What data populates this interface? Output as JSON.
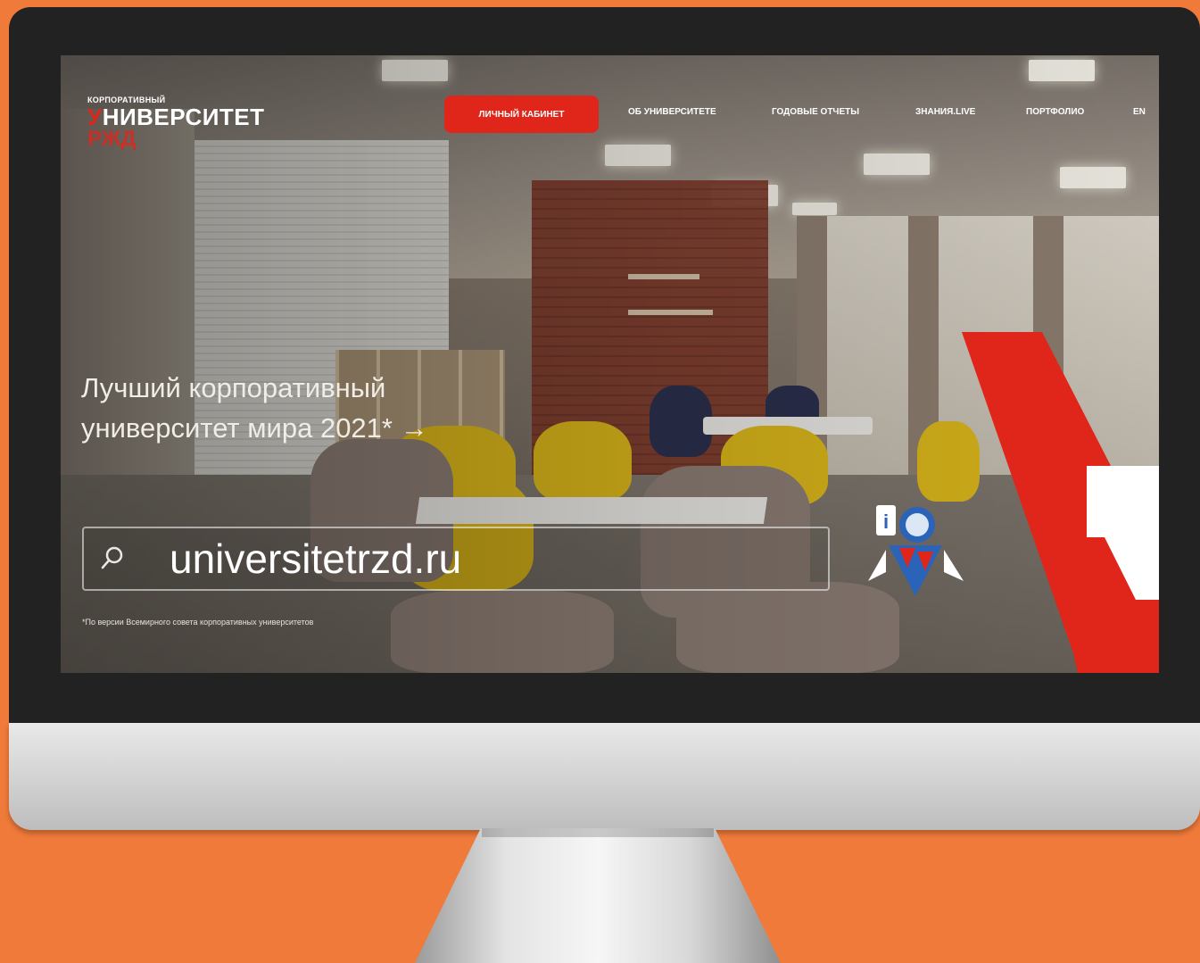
{
  "site": {
    "logo": {
      "small": "КОРПОРАТИВНЫЙ",
      "main_first_letter": "У",
      "main_rest": "НИВЕРСИТЕТ",
      "sub": "РЖД"
    },
    "nav": {
      "cabinet_button": "ЛИЧНЫЙ КАБИНЕТ",
      "items": [
        "ОБ УНИВЕРСИТЕТЕ",
        "ГОДОВЫЕ ОТЧЕТЫ",
        "ЗНАНИЯ.LIVE",
        "ПОРТФОЛИО",
        "EN"
      ]
    },
    "hero": {
      "title_line1": "Лучший корпоративный",
      "title_line2": "университет мира 2021* →"
    },
    "search": {
      "value": "universitetrzd.ru",
      "icon": "search-icon"
    },
    "footnote": "*По версии Всемирного совета корпоративных университетов"
  },
  "colors": {
    "background": "#f07a3a",
    "brand_red": "#e0261b",
    "bezel": "#222223"
  }
}
